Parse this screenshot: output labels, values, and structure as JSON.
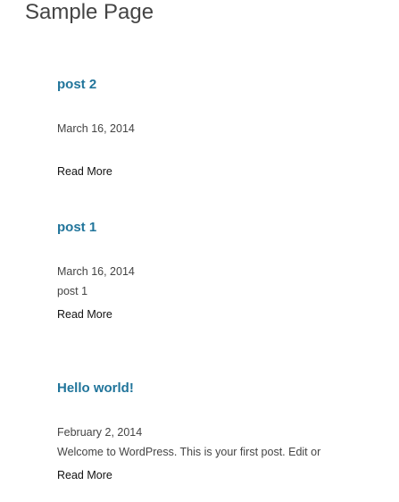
{
  "page": {
    "title": "Sample Page"
  },
  "posts": [
    {
      "title": "post 2",
      "date": "March 16, 2014",
      "excerpt": "",
      "read_more": "Read More"
    },
    {
      "title": "post 1",
      "date": "March 16, 2014",
      "excerpt": "post 1",
      "read_more": "Read More"
    },
    {
      "title": "Hello world!",
      "date": "February 2, 2014",
      "excerpt": "Welcome to WordPress. This is your first post. Edit or",
      "read_more": "Read More"
    }
  ],
  "colors": {
    "post_title_link": "#21759b",
    "body_text": "#444444",
    "read_more_link": "#111111"
  }
}
